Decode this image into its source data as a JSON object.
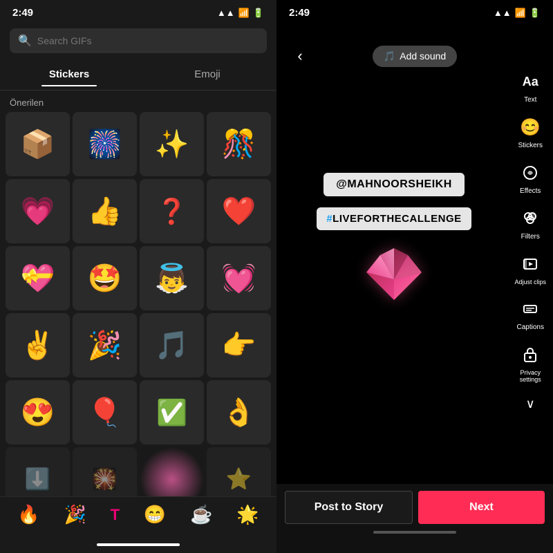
{
  "left": {
    "status_time": "2:49",
    "status_icons": "▲ ▲ 🔋",
    "search_placeholder": "Search GIFs",
    "tabs": [
      {
        "label": "Stickers",
        "active": true
      },
      {
        "label": "Emoji",
        "active": false
      }
    ],
    "section_label": "Önerilen",
    "stickers": [
      "📦",
      "🎆",
      "✨",
      "🎊",
      "💗",
      "👍",
      "❓",
      "❤️",
      "💝",
      "🤩",
      "👼",
      "💓",
      "✌️",
      "🎉",
      "🎵",
      "👉",
      "😍",
      "🎈",
      "✅",
      "👌",
      "⬇️",
      "🎇",
      "✨",
      "⭐"
    ],
    "bottom_emojis": [
      "🔥",
      "🎉",
      "🅣",
      "😁",
      "☕",
      "🌟"
    ]
  },
  "right": {
    "status_time": "2:49",
    "back_icon": "‹",
    "add_sound_label": "Add sound",
    "tools": [
      {
        "icon": "Aa",
        "label": "Text"
      },
      {
        "icon": "😊",
        "label": "Stickers"
      },
      {
        "icon": "⟳",
        "label": "Effects"
      },
      {
        "icon": "🎨",
        "label": "Filters"
      },
      {
        "icon": "✂️",
        "label": "Adjust clips"
      },
      {
        "icon": "≡",
        "label": "Captions"
      },
      {
        "icon": "🔒",
        "label": "Privacy\nsettings"
      }
    ],
    "mention": "@MAHNOORSHEIKH",
    "hashtag": "#LIVEFORTHECALLENGE",
    "chevron": "∨",
    "buttons": {
      "post_story": "Post to Story",
      "next": "Next"
    }
  }
}
